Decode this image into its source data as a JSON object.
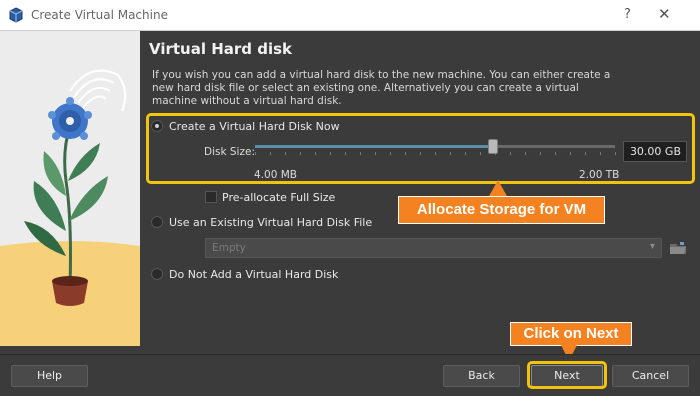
{
  "window": {
    "title": "Create Virtual Machine",
    "help_glyph": "?",
    "close_glyph": "✕"
  },
  "page": {
    "heading": "Virtual Hard disk",
    "description": "If you wish you can add a virtual hard disk to the new machine. You can either create a new hard disk file or select an existing one. Alternatively you can create a virtual machine without a virtual hard disk."
  },
  "options": {
    "create_now": {
      "label": "Create a Virtual Hard Disk Now",
      "selected": true
    },
    "use_existing": {
      "label": "Use an Existing Virtual Hard Disk File",
      "selected": false
    },
    "do_not_add": {
      "label": "Do Not Add a Virtual Hard Disk",
      "selected": false
    }
  },
  "disk": {
    "size_label": "Disk Size:",
    "size_value": "30.00 GB",
    "min_label": "4.00 MB",
    "max_label": "2.00 TB",
    "slider_fraction": 0.66,
    "preallocate_label": "Pre-allocate Full Size",
    "preallocate_checked": false
  },
  "existing_file": {
    "combo_value": "Empty"
  },
  "callouts": {
    "storage": "Allocate Storage for VM",
    "next": "Click on Next"
  },
  "buttons": {
    "help": "Help",
    "back": "Back",
    "next": "Next",
    "cancel": "Cancel"
  },
  "colors": {
    "highlight": "#f1c40f",
    "callout": "#f58220",
    "slider_fill": "#5c8ea8"
  }
}
